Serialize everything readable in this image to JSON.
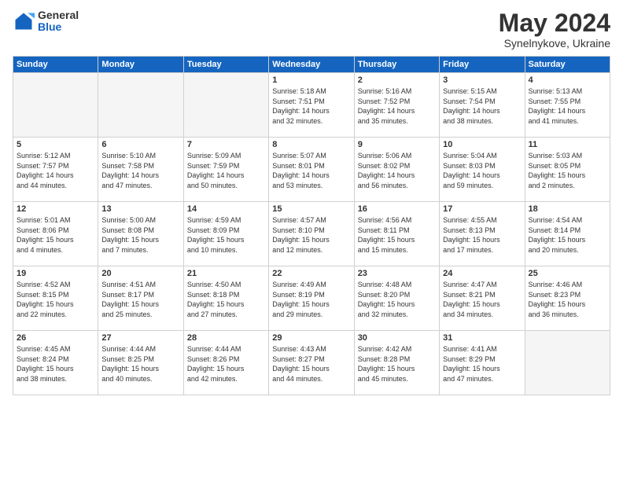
{
  "logo": {
    "general": "General",
    "blue": "Blue"
  },
  "title": {
    "month_year": "May 2024",
    "location": "Synelnykove, Ukraine"
  },
  "days_of_week": [
    "Sunday",
    "Monday",
    "Tuesday",
    "Wednesday",
    "Thursday",
    "Friday",
    "Saturday"
  ],
  "weeks": [
    [
      {
        "day": "",
        "info": ""
      },
      {
        "day": "",
        "info": ""
      },
      {
        "day": "",
        "info": ""
      },
      {
        "day": "1",
        "info": "Sunrise: 5:18 AM\nSunset: 7:51 PM\nDaylight: 14 hours\nand 32 minutes."
      },
      {
        "day": "2",
        "info": "Sunrise: 5:16 AM\nSunset: 7:52 PM\nDaylight: 14 hours\nand 35 minutes."
      },
      {
        "day": "3",
        "info": "Sunrise: 5:15 AM\nSunset: 7:54 PM\nDaylight: 14 hours\nand 38 minutes."
      },
      {
        "day": "4",
        "info": "Sunrise: 5:13 AM\nSunset: 7:55 PM\nDaylight: 14 hours\nand 41 minutes."
      }
    ],
    [
      {
        "day": "5",
        "info": "Sunrise: 5:12 AM\nSunset: 7:57 PM\nDaylight: 14 hours\nand 44 minutes."
      },
      {
        "day": "6",
        "info": "Sunrise: 5:10 AM\nSunset: 7:58 PM\nDaylight: 14 hours\nand 47 minutes."
      },
      {
        "day": "7",
        "info": "Sunrise: 5:09 AM\nSunset: 7:59 PM\nDaylight: 14 hours\nand 50 minutes."
      },
      {
        "day": "8",
        "info": "Sunrise: 5:07 AM\nSunset: 8:01 PM\nDaylight: 14 hours\nand 53 minutes."
      },
      {
        "day": "9",
        "info": "Sunrise: 5:06 AM\nSunset: 8:02 PM\nDaylight: 14 hours\nand 56 minutes."
      },
      {
        "day": "10",
        "info": "Sunrise: 5:04 AM\nSunset: 8:03 PM\nDaylight: 14 hours\nand 59 minutes."
      },
      {
        "day": "11",
        "info": "Sunrise: 5:03 AM\nSunset: 8:05 PM\nDaylight: 15 hours\nand 2 minutes."
      }
    ],
    [
      {
        "day": "12",
        "info": "Sunrise: 5:01 AM\nSunset: 8:06 PM\nDaylight: 15 hours\nand 4 minutes."
      },
      {
        "day": "13",
        "info": "Sunrise: 5:00 AM\nSunset: 8:08 PM\nDaylight: 15 hours\nand 7 minutes."
      },
      {
        "day": "14",
        "info": "Sunrise: 4:59 AM\nSunset: 8:09 PM\nDaylight: 15 hours\nand 10 minutes."
      },
      {
        "day": "15",
        "info": "Sunrise: 4:57 AM\nSunset: 8:10 PM\nDaylight: 15 hours\nand 12 minutes."
      },
      {
        "day": "16",
        "info": "Sunrise: 4:56 AM\nSunset: 8:11 PM\nDaylight: 15 hours\nand 15 minutes."
      },
      {
        "day": "17",
        "info": "Sunrise: 4:55 AM\nSunset: 8:13 PM\nDaylight: 15 hours\nand 17 minutes."
      },
      {
        "day": "18",
        "info": "Sunrise: 4:54 AM\nSunset: 8:14 PM\nDaylight: 15 hours\nand 20 minutes."
      }
    ],
    [
      {
        "day": "19",
        "info": "Sunrise: 4:52 AM\nSunset: 8:15 PM\nDaylight: 15 hours\nand 22 minutes."
      },
      {
        "day": "20",
        "info": "Sunrise: 4:51 AM\nSunset: 8:17 PM\nDaylight: 15 hours\nand 25 minutes."
      },
      {
        "day": "21",
        "info": "Sunrise: 4:50 AM\nSunset: 8:18 PM\nDaylight: 15 hours\nand 27 minutes."
      },
      {
        "day": "22",
        "info": "Sunrise: 4:49 AM\nSunset: 8:19 PM\nDaylight: 15 hours\nand 29 minutes."
      },
      {
        "day": "23",
        "info": "Sunrise: 4:48 AM\nSunset: 8:20 PM\nDaylight: 15 hours\nand 32 minutes."
      },
      {
        "day": "24",
        "info": "Sunrise: 4:47 AM\nSunset: 8:21 PM\nDaylight: 15 hours\nand 34 minutes."
      },
      {
        "day": "25",
        "info": "Sunrise: 4:46 AM\nSunset: 8:23 PM\nDaylight: 15 hours\nand 36 minutes."
      }
    ],
    [
      {
        "day": "26",
        "info": "Sunrise: 4:45 AM\nSunset: 8:24 PM\nDaylight: 15 hours\nand 38 minutes."
      },
      {
        "day": "27",
        "info": "Sunrise: 4:44 AM\nSunset: 8:25 PM\nDaylight: 15 hours\nand 40 minutes."
      },
      {
        "day": "28",
        "info": "Sunrise: 4:44 AM\nSunset: 8:26 PM\nDaylight: 15 hours\nand 42 minutes."
      },
      {
        "day": "29",
        "info": "Sunrise: 4:43 AM\nSunset: 8:27 PM\nDaylight: 15 hours\nand 44 minutes."
      },
      {
        "day": "30",
        "info": "Sunrise: 4:42 AM\nSunset: 8:28 PM\nDaylight: 15 hours\nand 45 minutes."
      },
      {
        "day": "31",
        "info": "Sunrise: 4:41 AM\nSunset: 8:29 PM\nDaylight: 15 hours\nand 47 minutes."
      },
      {
        "day": "",
        "info": ""
      }
    ]
  ]
}
